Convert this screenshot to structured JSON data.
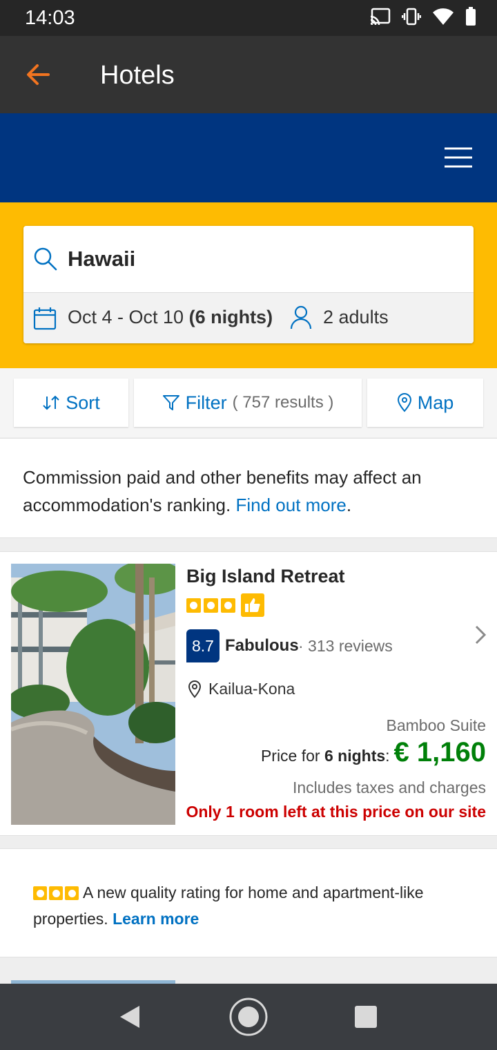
{
  "status": {
    "time": "14:03"
  },
  "appbar": {
    "title": "Hotels"
  },
  "search": {
    "destination": "Hawaii",
    "dates": "Oct 4 - Oct 10",
    "nights": "(6 nights)",
    "guests": "2 adults"
  },
  "toolbar": {
    "sort_label": "Sort",
    "filter_label": "Filter",
    "results": "( 757 results )",
    "map_label": "Map"
  },
  "notice": {
    "text": "Commission paid and other benefits may affect an accommodation's ranking.",
    "link": "Find out more",
    "end": "."
  },
  "hotel": {
    "name": "Big Island Retreat",
    "rating_squares": 3,
    "score": "8.7",
    "score_word": "Fabulous",
    "reviews": "· 313 reviews",
    "location": "Kailua-Kona",
    "room_type": "Bamboo Suite",
    "price_prefix": "Price for",
    "price_nights": "6 nights",
    "price_suffix": ":",
    "price": "€ 1,160",
    "taxes": "Includes taxes and charges",
    "scarcity": "Only 1 room left at this price on our site"
  },
  "quality": {
    "text": "A new quality rating for home and apartment-like properties.",
    "link": "Learn more"
  },
  "colors": {
    "brand_blue": "#003580",
    "accent_yellow": "#febb02",
    "link_blue": "#0071c2",
    "price_green": "#008009",
    "alert_red": "#cc0000",
    "back_orange": "#f27420"
  }
}
